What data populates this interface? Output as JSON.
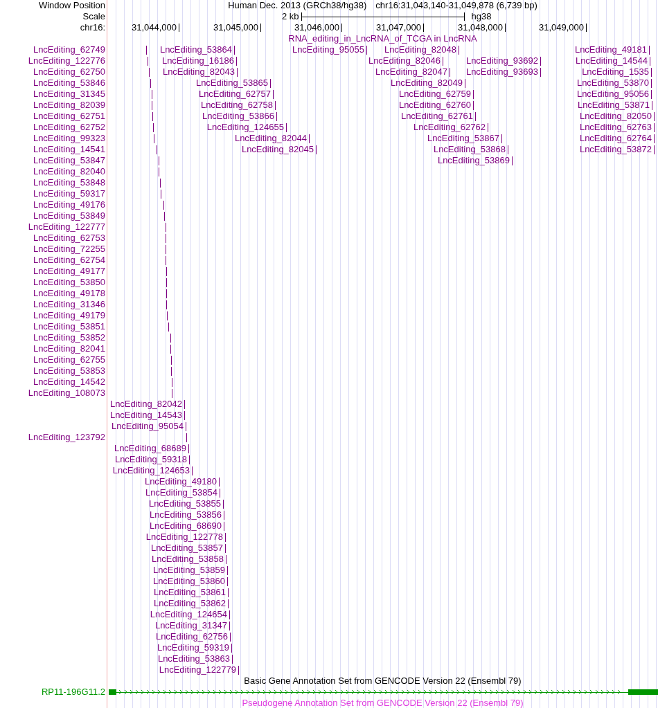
{
  "header": {
    "title": "Human Dec. 2013 (GRCh38/hg38)",
    "position": "chr16:31,043,140-31,049,878 (6,739 bp)"
  },
  "side_labels": {
    "window_position": "Window Position",
    "scale": "Scale",
    "chromosome": "chr16:"
  },
  "scale_bar": {
    "length": "2 kb",
    "assembly": "hg38"
  },
  "ruler": {
    "ticks": [
      "31,044,000",
      "31,045,000",
      "31,046,000",
      "31,047,000",
      "31,048,000",
      "31,049,000"
    ]
  },
  "tracks": [
    {
      "kind": "features",
      "title": "RNA_editing_in_LncRNA_of_TCGA in LncRNA",
      "color": "#800080",
      "rows": [
        {
          "side_label": "LncEditing_62749",
          "items": [
            "LncEditing_53864",
            "LncEditing_95055",
            "LncEditing_82048",
            "LncEditing_49181"
          ]
        },
        {
          "side_label": "LncEditing_122776",
          "items": [
            "LncEditing_16186",
            "LncEditing_82046",
            "LncEditing_93692",
            "LncEditing_14544"
          ]
        },
        {
          "side_label": "LncEditing_62750",
          "items": [
            "LncEditing_82043",
            "LncEditing_82047",
            "LncEditing_93693",
            "LncEditing_1535"
          ]
        },
        {
          "side_label": "LncEditing_53846",
          "items": [
            "LncEditing_53865",
            "LncEditing_82049",
            "LncEditing_53870"
          ]
        },
        {
          "side_label": "LncEditing_31345",
          "items": [
            "LncEditing_62757",
            "LncEditing_62759",
            "LncEditing_95056"
          ]
        },
        {
          "side_label": "LncEditing_82039",
          "items": [
            "LncEditing_62758",
            "LncEditing_62760",
            "LncEditing_53871"
          ]
        },
        {
          "side_label": "LncEditing_62751",
          "items": [
            "LncEditing_53866",
            "LncEditing_62761",
            "LncEditing_82050"
          ]
        },
        {
          "side_label": "LncEditing_62752",
          "items": [
            "LncEditing_124655",
            "LncEditing_62762",
            "LncEditing_62763"
          ]
        },
        {
          "side_label": "LncEditing_99323",
          "items": [
            "LncEditing_82044",
            "LncEditing_53867",
            "LncEditing_62764"
          ]
        },
        {
          "side_label": "LncEditing_14541",
          "items": [
            "LncEditing_82045",
            "LncEditing_53868",
            "LncEditing_53872"
          ]
        },
        {
          "side_label": "LncEditing_53847",
          "items": [
            "LncEditing_53869"
          ]
        },
        {
          "side_label": "LncEditing_82040"
        },
        {
          "side_label": "LncEditing_53848"
        },
        {
          "side_label": "LncEditing_59317"
        },
        {
          "side_label": "LncEditing_49176"
        },
        {
          "side_label": "LncEditing_53849"
        },
        {
          "side_label": "LncEditing_122777"
        },
        {
          "side_label": "LncEditing_62753"
        },
        {
          "side_label": "LncEditing_72255"
        },
        {
          "side_label": "LncEditing_62754"
        },
        {
          "side_label": "LncEditing_49177"
        },
        {
          "side_label": "LncEditing_53850"
        },
        {
          "side_label": "LncEditing_49178"
        },
        {
          "side_label": "LncEditing_31346"
        },
        {
          "side_label": "LncEditing_49179"
        },
        {
          "side_label": "LncEditing_53851"
        },
        {
          "side_label": "LncEditing_53852"
        },
        {
          "side_label": "LncEditing_82041"
        },
        {
          "side_label": "LncEditing_62755"
        },
        {
          "side_label": "LncEditing_53853"
        },
        {
          "side_label": "LncEditing_14542"
        },
        {
          "side_label": "LncEditing_108073"
        },
        {
          "items": [
            "LncEditing_82042"
          ]
        },
        {
          "items": [
            "LncEditing_14543"
          ]
        },
        {
          "items": [
            "LncEditing_95054"
          ]
        },
        {
          "side_label": "LncEditing_123792"
        },
        {
          "items": [
            "LncEditing_68689"
          ]
        },
        {
          "items": [
            "LncEditing_59318"
          ]
        },
        {
          "items": [
            "LncEditing_124653"
          ]
        },
        {
          "items": [
            "LncEditing_49180"
          ]
        },
        {
          "items": [
            "LncEditing_53854"
          ]
        },
        {
          "items": [
            "LncEditing_53855"
          ]
        },
        {
          "items": [
            "LncEditing_53856"
          ]
        },
        {
          "items": [
            "LncEditing_68690"
          ]
        },
        {
          "items": [
            "LncEditing_122778"
          ]
        },
        {
          "items": [
            "LncEditing_53857"
          ]
        },
        {
          "items": [
            "LncEditing_53858"
          ]
        },
        {
          "items": [
            "LncEditing_53859"
          ]
        },
        {
          "items": [
            "LncEditing_53860"
          ]
        },
        {
          "items": [
            "LncEditing_53861"
          ]
        },
        {
          "items": [
            "LncEditing_53862"
          ]
        },
        {
          "items": [
            "LncEditing_124654"
          ]
        },
        {
          "items": [
            "LncEditing_31347"
          ]
        },
        {
          "items": [
            "LncEditing_62756"
          ]
        },
        {
          "items": [
            "LncEditing_59319"
          ]
        },
        {
          "items": [
            "LncEditing_53863"
          ]
        },
        {
          "items": [
            "LncEditing_122779"
          ]
        }
      ]
    },
    {
      "kind": "genes",
      "title": "Basic Gene Annotation Set from GENCODE Version 22 (Ensembl 79)",
      "color": "#000000",
      "genes": [
        {
          "name": "RP11-196G11.2",
          "color": "#009600"
        }
      ]
    },
    {
      "kind": "genes",
      "title": "Pseudogene Annotation Set from GENCODE Version 22 (Ensembl 79)",
      "color": "#e040e0"
    }
  ]
}
